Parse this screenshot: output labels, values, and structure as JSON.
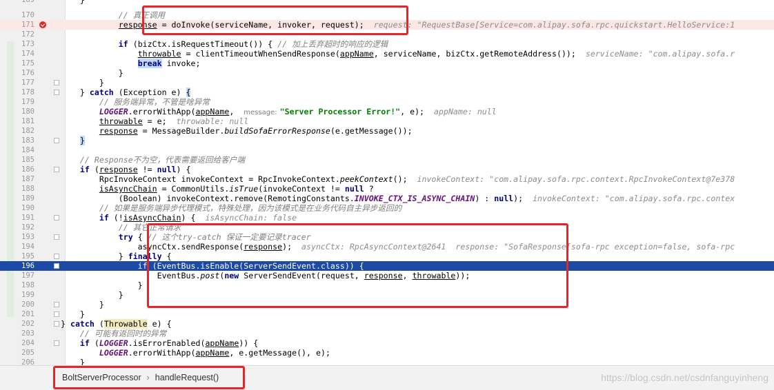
{
  "lines": [
    {
      "num": "170",
      "text": [
        {
          "t": "            "
        },
        {
          "t": "// 真正调用",
          "c": "cm"
        }
      ]
    },
    {
      "num": "171",
      "bp": true,
      "hl": "bp",
      "text": [
        {
          "t": "            "
        },
        {
          "t": "response",
          "c": "u"
        },
        {
          "t": " = doInvoke(serviceName, invoker, request);  "
        },
        {
          "t": "request: \"RequestBase[Service=com.alipay.sofa.rpc.quickstart.HelloService:1",
          "c": "hint"
        }
      ]
    },
    {
      "num": "172",
      "text": []
    },
    {
      "num": "173",
      "text": [
        {
          "t": "            "
        },
        {
          "t": "if",
          "c": "kw"
        },
        {
          "t": " (bizCtx.isRequestTimeout()) { "
        },
        {
          "t": "// 加上丢弃超时的响应的逻辑",
          "c": "cm"
        }
      ]
    },
    {
      "num": "174",
      "text": [
        {
          "t": "                "
        },
        {
          "t": "throwable",
          "c": "u"
        },
        {
          "t": " = clientTimeoutWhenSendResponse("
        },
        {
          "t": "appName",
          "c": "u"
        },
        {
          "t": ", serviceName, bizCtx.getRemoteAddress());  "
        },
        {
          "t": "serviceName: \"com.alipay.sofa.r",
          "c": "hint"
        }
      ]
    },
    {
      "num": "175",
      "text": [
        {
          "t": "                "
        },
        {
          "t": "break",
          "c": "kw sel"
        },
        {
          "t": " invoke;"
        }
      ]
    },
    {
      "num": "176",
      "text": [
        {
          "t": "            }"
        }
      ]
    },
    {
      "num": "177",
      "fold": true,
      "text": [
        {
          "t": "        }"
        }
      ]
    },
    {
      "num": "178",
      "fold": true,
      "text": [
        {
          "t": "    } "
        },
        {
          "t": "catch",
          "c": "kw"
        },
        {
          "t": " (Exception e) "
        },
        {
          "t": "{",
          "c": "sel"
        }
      ]
    },
    {
      "num": "179",
      "text": [
        {
          "t": "        "
        },
        {
          "t": "// 服务端异常，不管是啥异常",
          "c": "cm"
        }
      ]
    },
    {
      "num": "180",
      "text": [
        {
          "t": "        "
        },
        {
          "t": "LOGGER",
          "c": "fld"
        },
        {
          "t": ".errorWithApp("
        },
        {
          "t": "appName",
          "c": "u"
        },
        {
          "t": ",  "
        },
        {
          "t": "message:",
          "c": "ph"
        },
        {
          "t": "\"Server Processor Error!\"",
          "c": "str"
        },
        {
          "t": ", e);  "
        },
        {
          "t": "appName: null",
          "c": "hint"
        }
      ]
    },
    {
      "num": "181",
      "text": [
        {
          "t": "        "
        },
        {
          "t": "throwable",
          "c": "u"
        },
        {
          "t": " = e;  "
        },
        {
          "t": "throwable: null",
          "c": "hint"
        }
      ]
    },
    {
      "num": "182",
      "text": [
        {
          "t": "        "
        },
        {
          "t": "response",
          "c": "u"
        },
        {
          "t": " = MessageBuilder."
        },
        {
          "t": "buildSofaErrorResponse",
          "c": "st"
        },
        {
          "t": "(e.getMessage());"
        }
      ]
    },
    {
      "num": "183",
      "fold": true,
      "text": [
        {
          "t": "    "
        },
        {
          "t": "}",
          "c": "sel"
        }
      ]
    },
    {
      "num": "184",
      "text": []
    },
    {
      "num": "185",
      "text": [
        {
          "t": "    "
        },
        {
          "t": "// Response不为空，代表需要返回给客户端",
          "c": "cm"
        }
      ]
    },
    {
      "num": "186",
      "fold": true,
      "text": [
        {
          "t": "    "
        },
        {
          "t": "if",
          "c": "kw"
        },
        {
          "t": " ("
        },
        {
          "t": "response",
          "c": "u"
        },
        {
          "t": " != "
        },
        {
          "t": "null",
          "c": "kw"
        },
        {
          "t": ") {"
        }
      ]
    },
    {
      "num": "187",
      "text": [
        {
          "t": "        RpcInvokeContext invokeContext = RpcInvokeContext."
        },
        {
          "t": "peekContext",
          "c": "st"
        },
        {
          "t": "();  "
        },
        {
          "t": "invokeContext: \"com.alipay.sofa.rpc.context.RpcInvokeContext@7e378",
          "c": "hint"
        }
      ]
    },
    {
      "num": "188",
      "text": [
        {
          "t": "        "
        },
        {
          "t": "isAsyncChain",
          "c": "u"
        },
        {
          "t": " = CommonUtils."
        },
        {
          "t": "isTrue",
          "c": "st"
        },
        {
          "t": "(invokeContext != "
        },
        {
          "t": "null",
          "c": "kw"
        },
        {
          "t": " ?"
        }
      ]
    },
    {
      "num": "189",
      "text": [
        {
          "t": "            (Boolean) invokeContext.remove(RemotingConstants."
        },
        {
          "t": "INVOKE_CTX_IS_ASYNC_CHAIN",
          "c": "fld"
        },
        {
          "t": ") : "
        },
        {
          "t": "null",
          "c": "kw"
        },
        {
          "t": ");  "
        },
        {
          "t": "invokeContext: \"com.alipay.sofa.rpc.contex",
          "c": "hint"
        }
      ]
    },
    {
      "num": "190",
      "text": [
        {
          "t": "        "
        },
        {
          "t": "// 如果是服务端异步代理模式，特殊处理，因为该模式是在业务代码自主异步返回的",
          "c": "cm"
        }
      ]
    },
    {
      "num": "191",
      "fold": true,
      "text": [
        {
          "t": "        "
        },
        {
          "t": "if",
          "c": "kw"
        },
        {
          "t": " (!"
        },
        {
          "t": "isAsyncChain",
          "c": "u"
        },
        {
          "t": ") {  "
        },
        {
          "t": "isAsyncChain: false",
          "c": "hint"
        }
      ]
    },
    {
      "num": "192",
      "text": [
        {
          "t": "            "
        },
        {
          "t": "// 其它正常请求",
          "c": "cm"
        }
      ]
    },
    {
      "num": "193",
      "fold": true,
      "text": [
        {
          "t": "            "
        },
        {
          "t": "try",
          "c": "kw"
        },
        {
          "t": " { "
        },
        {
          "t": "// 这个try-catch 保证一定要记录tracer",
          "c": "cm"
        }
      ]
    },
    {
      "num": "194",
      "text": [
        {
          "t": "                asyncCtx.sendResponse("
        },
        {
          "t": "response",
          "c": "u"
        },
        {
          "t": ");  "
        },
        {
          "t": "asyncCtx: RpcAsyncContext@2641  response: \"SofaResponse[sofa-rpc exception=false, sofa-rpc",
          "c": "hint"
        }
      ]
    },
    {
      "num": "195",
      "fold": true,
      "text": [
        {
          "t": "            } "
        },
        {
          "t": "finally",
          "c": "kw"
        },
        {
          "t": " {"
        }
      ]
    },
    {
      "num": "196",
      "fold": true,
      "hl": "exec",
      "text": [
        {
          "t": "                if (EventBus.isEnable(ServerSendEvent.class)) {"
        }
      ]
    },
    {
      "num": "197",
      "text": [
        {
          "t": "                    EventBus."
        },
        {
          "t": "post",
          "c": "st"
        },
        {
          "t": "("
        },
        {
          "t": "new",
          "c": "kw"
        },
        {
          "t": " ServerSendEvent(request, "
        },
        {
          "t": "response",
          "c": "u"
        },
        {
          "t": ", "
        },
        {
          "t": "throwable",
          "c": "u"
        },
        {
          "t": "));"
        }
      ]
    },
    {
      "num": "198",
      "text": [
        {
          "t": "                }"
        }
      ]
    },
    {
      "num": "199",
      "text": [
        {
          "t": "            }"
        }
      ]
    },
    {
      "num": "200",
      "fold": true,
      "text": [
        {
          "t": "        }"
        }
      ]
    },
    {
      "num": "201",
      "fold": true,
      "text": [
        {
          "t": "    }"
        }
      ]
    },
    {
      "num": "202",
      "fold": true,
      "text": [
        {
          "t": "} "
        },
        {
          "t": "catch",
          "c": "kw"
        },
        {
          "t": " ("
        },
        {
          "t": "Throwable",
          "c": "hlw"
        },
        {
          "t": " e) {"
        }
      ]
    },
    {
      "num": "203",
      "text": [
        {
          "t": "    "
        },
        {
          "t": "// 可能有返回时的异常",
          "c": "cm"
        }
      ]
    },
    {
      "num": "204",
      "fold": true,
      "text": [
        {
          "t": "    "
        },
        {
          "t": "if",
          "c": "kw"
        },
        {
          "t": " ("
        },
        {
          "t": "LOGGER",
          "c": "fld"
        },
        {
          "t": ".isErrorEnabled("
        },
        {
          "t": "appName",
          "c": "u"
        },
        {
          "t": ")) {"
        }
      ]
    },
    {
      "num": "205",
      "text": [
        {
          "t": "        "
        },
        {
          "t": "LOGGER",
          "c": "fld"
        },
        {
          "t": ".errorWithApp("
        },
        {
          "t": "appName",
          "c": "u"
        },
        {
          "t": ", e.getMessage(), e);"
        }
      ]
    },
    {
      "num": "206",
      "text": [
        {
          "t": "    }"
        }
      ]
    }
  ],
  "top_partial": {
    "num": "169",
    "text": "    }"
  },
  "breadcrumb": {
    "class_name": "BoltServerProcessor",
    "separator": "›",
    "method_name": "handleRequest()"
  },
  "watermark": "https://blog.csdn.net/csdnfanguyinheng"
}
